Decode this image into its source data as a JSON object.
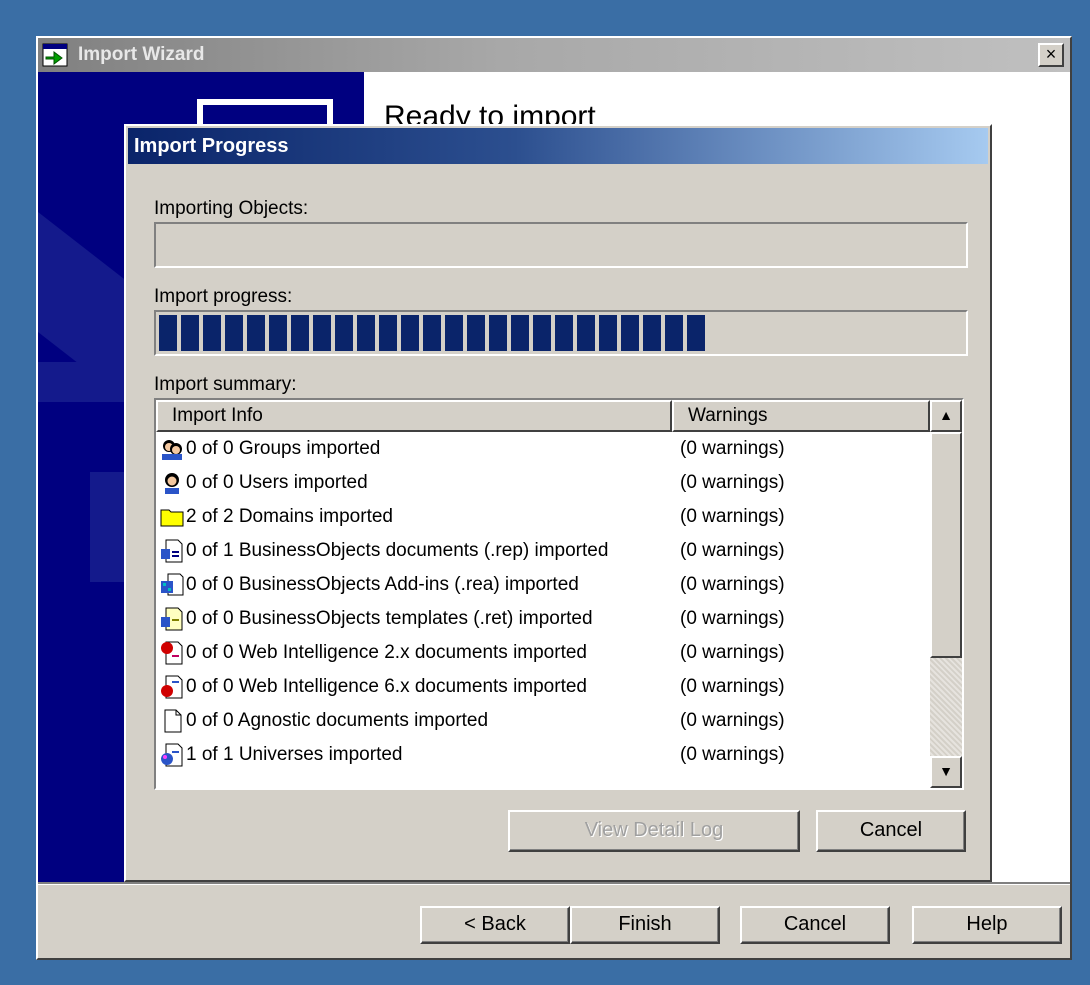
{
  "wizard": {
    "title": "Import Wizard",
    "heading": "Ready to import",
    "close_label": "×",
    "buttons": {
      "back": "< Back",
      "finish": "Finish",
      "cancel": "Cancel",
      "help": "Help"
    }
  },
  "dialog": {
    "title": "Import Progress",
    "importing_objects_label": "Importing Objects:",
    "importing_objects_value": "",
    "import_progress_label": "Import progress:",
    "progress": 0.7,
    "import_summary_label": "Import summary:",
    "columns": [
      "Import Info",
      "Warnings"
    ],
    "rows": [
      {
        "icon": "groups-icon",
        "text": "0 of 0 Groups imported",
        "warnings": "(0 warnings)"
      },
      {
        "icon": "user-icon",
        "text": "0 of 0 Users imported",
        "warnings": "(0 warnings)"
      },
      {
        "icon": "folder-icon",
        "text": "2 of 2 Domains imported",
        "warnings": "(0 warnings)"
      },
      {
        "icon": "rep-document-icon",
        "text": "0 of 1 BusinessObjects documents (.rep) imported",
        "warnings": "(0 warnings)"
      },
      {
        "icon": "addin-icon",
        "text": "0 of 0 BusinessObjects Add-ins (.rea) imported",
        "warnings": "(0 warnings)"
      },
      {
        "icon": "template-icon",
        "text": "0 of 0 BusinessObjects templates (.ret) imported",
        "warnings": "(0 warnings)"
      },
      {
        "icon": "webi2-document-icon",
        "text": "0 of 0 Web Intelligence 2.x documents imported",
        "warnings": "(0 warnings)"
      },
      {
        "icon": "webi6-document-icon",
        "text": "0 of 0 Web Intelligence 6.x documents imported",
        "warnings": "(0 warnings)"
      },
      {
        "icon": "blank-document-icon",
        "text": "0 of 0 Agnostic documents imported",
        "warnings": "(0 warnings)"
      },
      {
        "icon": "universe-icon",
        "text": "1 of 1 Universes imported",
        "warnings": "(0 warnings)"
      }
    ],
    "buttons": {
      "view_log": "View Detail Log",
      "cancel": "Cancel"
    },
    "colors": {
      "titlebar_start": "#0a246a",
      "titlebar_end": "#a6caf0",
      "progress": "#0a246a"
    }
  }
}
